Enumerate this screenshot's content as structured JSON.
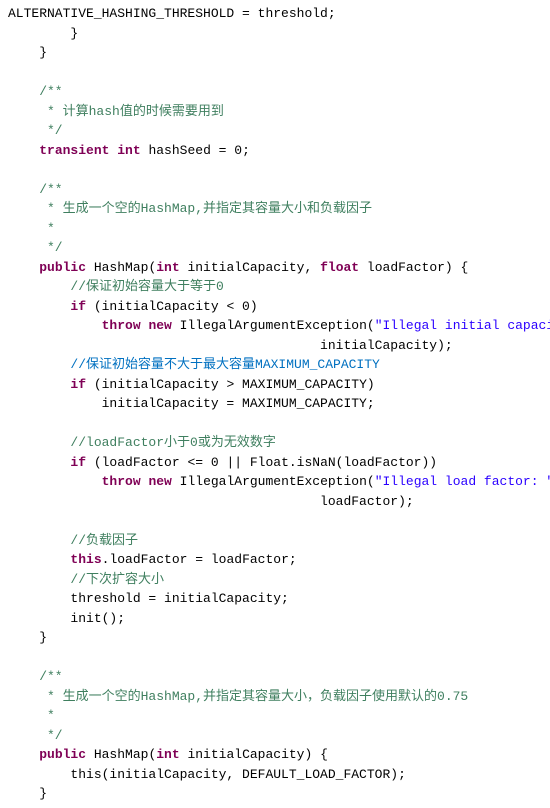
{
  "code": {
    "lines": [
      {
        "id": 1,
        "parts": [
          {
            "text": "ALTERNATIVE_HASHING_THRESHOLD = threshold;",
            "class": "id"
          }
        ]
      },
      {
        "id": 2,
        "parts": [
          {
            "text": "        }",
            "class": "id"
          }
        ]
      },
      {
        "id": 3,
        "parts": [
          {
            "text": "    }",
            "class": "id"
          }
        ]
      },
      {
        "id": 4,
        "parts": [
          {
            "text": "",
            "class": "id"
          }
        ]
      },
      {
        "id": 5,
        "parts": [
          {
            "text": "    /**",
            "class": "cm"
          }
        ]
      },
      {
        "id": 6,
        "parts": [
          {
            "text": "     * 计算hash值的时候需要用到",
            "class": "cm"
          }
        ]
      },
      {
        "id": 7,
        "parts": [
          {
            "text": "     */",
            "class": "cm"
          }
        ]
      },
      {
        "id": 8,
        "parts": [
          {
            "text": "    ",
            "class": "id"
          },
          {
            "text": "transient",
            "class": "kw"
          },
          {
            "text": " ",
            "class": "id"
          },
          {
            "text": "int",
            "class": "kw"
          },
          {
            "text": " hashSeed = 0;",
            "class": "id"
          }
        ]
      },
      {
        "id": 9,
        "parts": [
          {
            "text": "",
            "class": "id"
          }
        ]
      },
      {
        "id": 10,
        "parts": [
          {
            "text": "    /**",
            "class": "cm"
          }
        ]
      },
      {
        "id": 11,
        "parts": [
          {
            "text": "     * 生成一个空的HashMap,并指定其容量大小和负载因子",
            "class": "cm"
          }
        ]
      },
      {
        "id": 12,
        "parts": [
          {
            "text": "     *",
            "class": "cm"
          }
        ]
      },
      {
        "id": 13,
        "parts": [
          {
            "text": "     */",
            "class": "cm"
          }
        ]
      },
      {
        "id": 14,
        "parts": [
          {
            "text": "    ",
            "class": "id"
          },
          {
            "text": "public",
            "class": "kw"
          },
          {
            "text": " HashMap(",
            "class": "id"
          },
          {
            "text": "int",
            "class": "kw"
          },
          {
            "text": " initialCapacity, ",
            "class": "id"
          },
          {
            "text": "float",
            "class": "kw"
          },
          {
            "text": " loadFactor) {",
            "class": "id"
          }
        ]
      },
      {
        "id": 15,
        "parts": [
          {
            "text": "        //保证初始容量大于等于0",
            "class": "comment-cn"
          }
        ]
      },
      {
        "id": 16,
        "parts": [
          {
            "text": "        ",
            "class": "id"
          },
          {
            "text": "if",
            "class": "kw"
          },
          {
            "text": " (initialCapacity < 0)",
            "class": "id"
          }
        ]
      },
      {
        "id": 17,
        "parts": [
          {
            "text": "            ",
            "class": "id"
          },
          {
            "text": "throw",
            "class": "kw"
          },
          {
            "text": " ",
            "class": "id"
          },
          {
            "text": "new",
            "class": "kw"
          },
          {
            "text": " IllegalArgumentException(",
            "class": "id"
          },
          {
            "text": "\"Illegal initial capacity: \"",
            "class": "str"
          },
          {
            "text": " +",
            "class": "id"
          }
        ]
      },
      {
        "id": 18,
        "parts": [
          {
            "text": "                                        initialCapacity);",
            "class": "id"
          }
        ]
      },
      {
        "id": 19,
        "parts": [
          {
            "text": "        //保证初始容量不大于最大容量MAXIMUM_CAPACITY",
            "class": "blue-cn"
          }
        ]
      },
      {
        "id": 20,
        "parts": [
          {
            "text": "        ",
            "class": "id"
          },
          {
            "text": "if",
            "class": "kw"
          },
          {
            "text": " (initialCapacity > MAXIMUM_CAPACITY)",
            "class": "id"
          }
        ]
      },
      {
        "id": 21,
        "parts": [
          {
            "text": "            initialCapacity = MAXIMUM_CAPACITY;",
            "class": "id"
          }
        ]
      },
      {
        "id": 22,
        "parts": [
          {
            "text": "",
            "class": "id"
          }
        ]
      },
      {
        "id": 23,
        "parts": [
          {
            "text": "        //loadFactor小于0或为无效数字",
            "class": "comment-cn"
          }
        ]
      },
      {
        "id": 24,
        "parts": [
          {
            "text": "        ",
            "class": "id"
          },
          {
            "text": "if",
            "class": "kw"
          },
          {
            "text": " (loadFactor <= 0 || Float.isNaN(loadFactor))",
            "class": "id"
          }
        ]
      },
      {
        "id": 25,
        "parts": [
          {
            "text": "            ",
            "class": "id"
          },
          {
            "text": "throw",
            "class": "kw"
          },
          {
            "text": " ",
            "class": "id"
          },
          {
            "text": "new",
            "class": "kw"
          },
          {
            "text": " IllegalArgumentException(",
            "class": "id"
          },
          {
            "text": "\"Illegal load factor: \"",
            "class": "str"
          },
          {
            "text": " +",
            "class": "id"
          }
        ]
      },
      {
        "id": 26,
        "parts": [
          {
            "text": "                                        loadFactor);",
            "class": "id"
          }
        ]
      },
      {
        "id": 27,
        "parts": [
          {
            "text": "",
            "class": "id"
          }
        ]
      },
      {
        "id": 28,
        "parts": [
          {
            "text": "        //负载因子",
            "class": "comment-cn"
          }
        ]
      },
      {
        "id": 29,
        "parts": [
          {
            "text": "        ",
            "class": "id"
          },
          {
            "text": "this",
            "class": "kw"
          },
          {
            "text": ".loadFactor = loadFactor;",
            "class": "id"
          }
        ]
      },
      {
        "id": 30,
        "parts": [
          {
            "text": "        //下次扩容大小",
            "class": "comment-cn"
          }
        ]
      },
      {
        "id": 31,
        "parts": [
          {
            "text": "        threshold = initialCapacity;",
            "class": "id"
          }
        ]
      },
      {
        "id": 32,
        "parts": [
          {
            "text": "        init();",
            "class": "id"
          }
        ]
      },
      {
        "id": 33,
        "parts": [
          {
            "text": "    }",
            "class": "id"
          }
        ]
      },
      {
        "id": 34,
        "parts": [
          {
            "text": "",
            "class": "id"
          }
        ]
      },
      {
        "id": 35,
        "parts": [
          {
            "text": "    /**",
            "class": "cm"
          }
        ]
      },
      {
        "id": 36,
        "parts": [
          {
            "text": "     * 生成一个空的HashMap,并指定其容量大小，负载因子使用默认的0.75",
            "class": "cm"
          }
        ]
      },
      {
        "id": 37,
        "parts": [
          {
            "text": "     *",
            "class": "cm"
          }
        ]
      },
      {
        "id": 38,
        "parts": [
          {
            "text": "     */",
            "class": "cm"
          }
        ]
      },
      {
        "id": 39,
        "parts": [
          {
            "text": "    ",
            "class": "id"
          },
          {
            "text": "public",
            "class": "kw"
          },
          {
            "text": " HashMap(",
            "class": "id"
          },
          {
            "text": "int",
            "class": "kw"
          },
          {
            "text": " initialCapacity) {",
            "class": "id"
          }
        ]
      },
      {
        "id": 40,
        "parts": [
          {
            "text": "        this(initialCapacity, DEFAULT_LOAD_FACTOR);",
            "class": "id"
          }
        ]
      },
      {
        "id": 41,
        "parts": [
          {
            "text": "    }",
            "class": "id"
          }
        ]
      }
    ]
  }
}
